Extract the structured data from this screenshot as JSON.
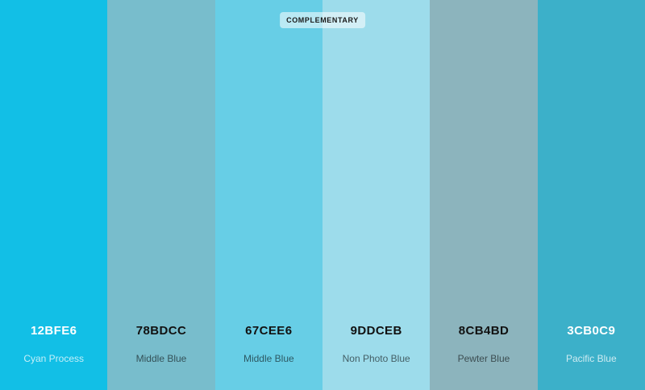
{
  "badge": "COMPLEMENTARY",
  "swatches": [
    {
      "hex": "12BFE6",
      "name": "Cyan Process",
      "color": "#12BFE6"
    },
    {
      "hex": "78BDCC",
      "name": "Middle Blue",
      "color": "#78BDCC"
    },
    {
      "hex": "67CEE6",
      "name": "Middle Blue",
      "color": "#67CEE6"
    },
    {
      "hex": "9DDCEB",
      "name": "Non Photo Blue",
      "color": "#9DDCEB"
    },
    {
      "hex": "8CB4BD",
      "name": "Pewter Blue",
      "color": "#8CB4BD"
    },
    {
      "hex": "3CB0C9",
      "name": "Pacific Blue",
      "color": "#3CB0C9"
    }
  ]
}
